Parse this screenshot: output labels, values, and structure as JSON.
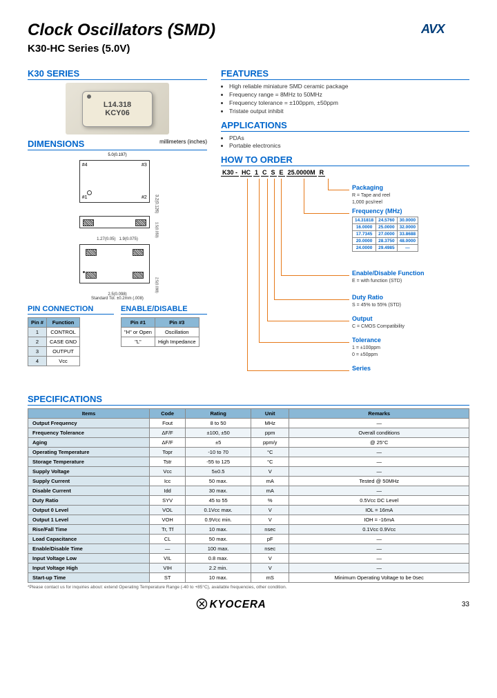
{
  "header": {
    "title": "Clock Oscillators (SMD)",
    "subtitle": "K30-HC Series (5.0V)",
    "logo": "AVX"
  },
  "series_box": {
    "heading": "K30 SERIES",
    "chip_line1": "L14.318",
    "chip_line2": "KCY06"
  },
  "dimensions": {
    "heading": "DIMENSIONS",
    "units": "millimeters (inches)",
    "note": "Standard Tol. ±0.2mm (.008)"
  },
  "pin_connection": {
    "heading": "PIN CONNECTION",
    "cols": [
      "Pin #",
      "Function"
    ],
    "rows": [
      [
        "1",
        "CONTROL"
      ],
      [
        "2",
        "CASE GND"
      ],
      [
        "3",
        "OUTPUT"
      ],
      [
        "4",
        "Vcc"
      ]
    ]
  },
  "enable_disable": {
    "heading": "ENABLE/DISABLE",
    "cols": [
      "Pin #1",
      "Pin #3"
    ],
    "rows": [
      [
        "\"H\" or Open",
        "Oscillation"
      ],
      [
        "\"L\"",
        "High Impedance"
      ]
    ]
  },
  "features": {
    "heading": "FEATURES",
    "items": [
      "High reliable miniature SMD ceramic package",
      "Frequency range = 8MHz to 50MHz",
      "Frequency tolerance = ±100ppm, ±50ppm",
      "Tristate output inhibit"
    ]
  },
  "applications": {
    "heading": "APPLICATIONS",
    "items": [
      "PDAs",
      "Portable electronics"
    ]
  },
  "how_to_order": {
    "heading": "HOW TO ORDER",
    "code": [
      "K30 -",
      "HC",
      "1",
      "C",
      "S",
      "E",
      "25.0000M",
      "R"
    ],
    "packaging": {
      "label": "Packaging",
      "note": "R = Tape and reel\n1,000 pcs/reel"
    },
    "frequency": {
      "label": "Frequency (MHz)",
      "table": [
        [
          "14.31818",
          "24.5760",
          "30.0000"
        ],
        [
          "16.0000",
          "25.0000",
          "32.0000"
        ],
        [
          "17.7345",
          "27.0000",
          "33.8688"
        ],
        [
          "20.0000",
          "28.3750",
          "48.0000"
        ],
        [
          "24.0000",
          "29.4985",
          "—"
        ]
      ]
    },
    "enable": {
      "label": "Enable/Disable Function",
      "note": "E = with function (STD)"
    },
    "duty": {
      "label": "Duty Ratio",
      "note": "S = 45% to 55% (STD)"
    },
    "output": {
      "label": "Output",
      "note": "C = CMOS Compatibility"
    },
    "tolerance": {
      "label": "Tolerance",
      "note": "1 = ±100ppm\n0 = ±50ppm"
    },
    "series": {
      "label": "Series"
    }
  },
  "specifications": {
    "heading": "SPECIFICATIONS",
    "cols": [
      "Items",
      "Code",
      "Rating",
      "Unit",
      "Remarks"
    ],
    "rows": [
      [
        "Output Frequency",
        "Fout",
        "8 to 50",
        "MHz",
        "—"
      ],
      [
        "Frequency Tolerance",
        "ΔF/F",
        "±100, ±50",
        "ppm",
        "Overall conditions"
      ],
      [
        "Aging",
        "ΔF/F",
        "±5",
        "ppm/y",
        "@ 25°C"
      ],
      [
        "Operating Temperature",
        "Topr",
        "-10 to 70",
        "°C",
        "—"
      ],
      [
        "Storage Temperature",
        "Tstr",
        "-55 to 125",
        "°C",
        "—"
      ],
      [
        "Supply Voltage",
        "Vcc",
        "5±0.5",
        "V",
        "—"
      ],
      [
        "Supply Current",
        "Icc",
        "50 max.",
        "mA",
        "Tested @ 50MHz"
      ],
      [
        "Disable Current",
        "Idd",
        "30 max.",
        "mA",
        "—"
      ],
      [
        "Duty Ratio",
        "SYV",
        "45 to 55",
        "%",
        "0.5Vcc DC Level"
      ],
      [
        "Output 0 Level",
        "VOL",
        "0.1Vcc max.",
        "V",
        "IOL = 16mA"
      ],
      [
        "Output 1 Level",
        "VOH",
        "0.9Vcc min.",
        "V",
        "IOH = -16mA"
      ],
      [
        "Rise/Fall Time",
        "Tr, Tf",
        "10 max.",
        "nsec",
        "0.1Vcc 0.9Vcc"
      ],
      [
        "Load Capacitance",
        "CL",
        "50 max.",
        "pF",
        "—"
      ],
      [
        "Enable/Disable Time",
        "—",
        "100 max.",
        "nsec",
        "—"
      ],
      [
        "Input Voltage Low",
        "VIL",
        "0.8 max.",
        "V",
        "—"
      ],
      [
        "Input Voltage High",
        "VIH",
        "2.2 min.",
        "V",
        "—"
      ],
      [
        "Start-up Time",
        "ST",
        "10 max.",
        "mS",
        "Minimum Operating Voltage to be 0sec"
      ]
    ]
  },
  "footnote": "*Please contact us for inquiries about: extend Operating Temperature Range (-40 to +85°C), available frequencies, other condition.",
  "footer": {
    "brand": "KYOCERA",
    "page": "33"
  }
}
